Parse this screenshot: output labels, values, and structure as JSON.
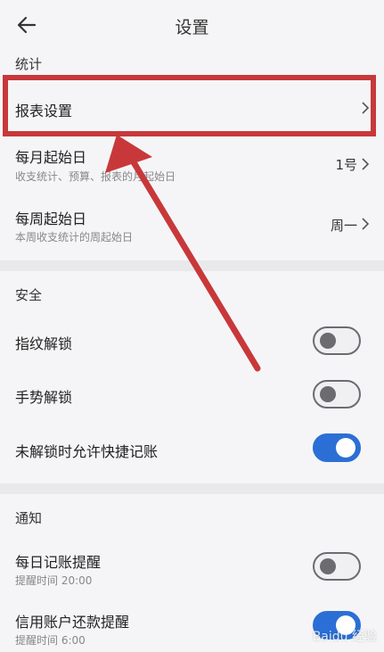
{
  "header": {
    "title": "设置",
    "back_icon": "back-arrow-icon"
  },
  "sections": {
    "stats": {
      "label": "统计",
      "report_settings": {
        "label": "报表设置"
      },
      "month_start": {
        "label": "每月起始日",
        "sub": "收支统计、预算、报表的月起始日",
        "value": "1号"
      },
      "week_start": {
        "label": "每周起始日",
        "sub": "本周收支统计的周起始日",
        "value": "周一"
      }
    },
    "security": {
      "label": "安全",
      "fingerprint": {
        "label": "指纹解锁",
        "on": false
      },
      "gesture": {
        "label": "手势解锁",
        "on": false
      },
      "quick_entry": {
        "label": "未解锁时允许快捷记账",
        "on": true
      }
    },
    "notify": {
      "label": "通知",
      "daily": {
        "label": "每日记账提醒",
        "sub": "提醒时间 20:00",
        "on": false
      },
      "credit": {
        "label": "信用账户还款提醒",
        "sub": "提醒时间 6:00",
        "on": true
      }
    }
  },
  "annotation": {
    "highlight_color": "#c8383a"
  },
  "colors": {
    "toggle_on": "#2b6fd6",
    "background": "#f5f5f7"
  },
  "watermark": "Baidu 经验"
}
